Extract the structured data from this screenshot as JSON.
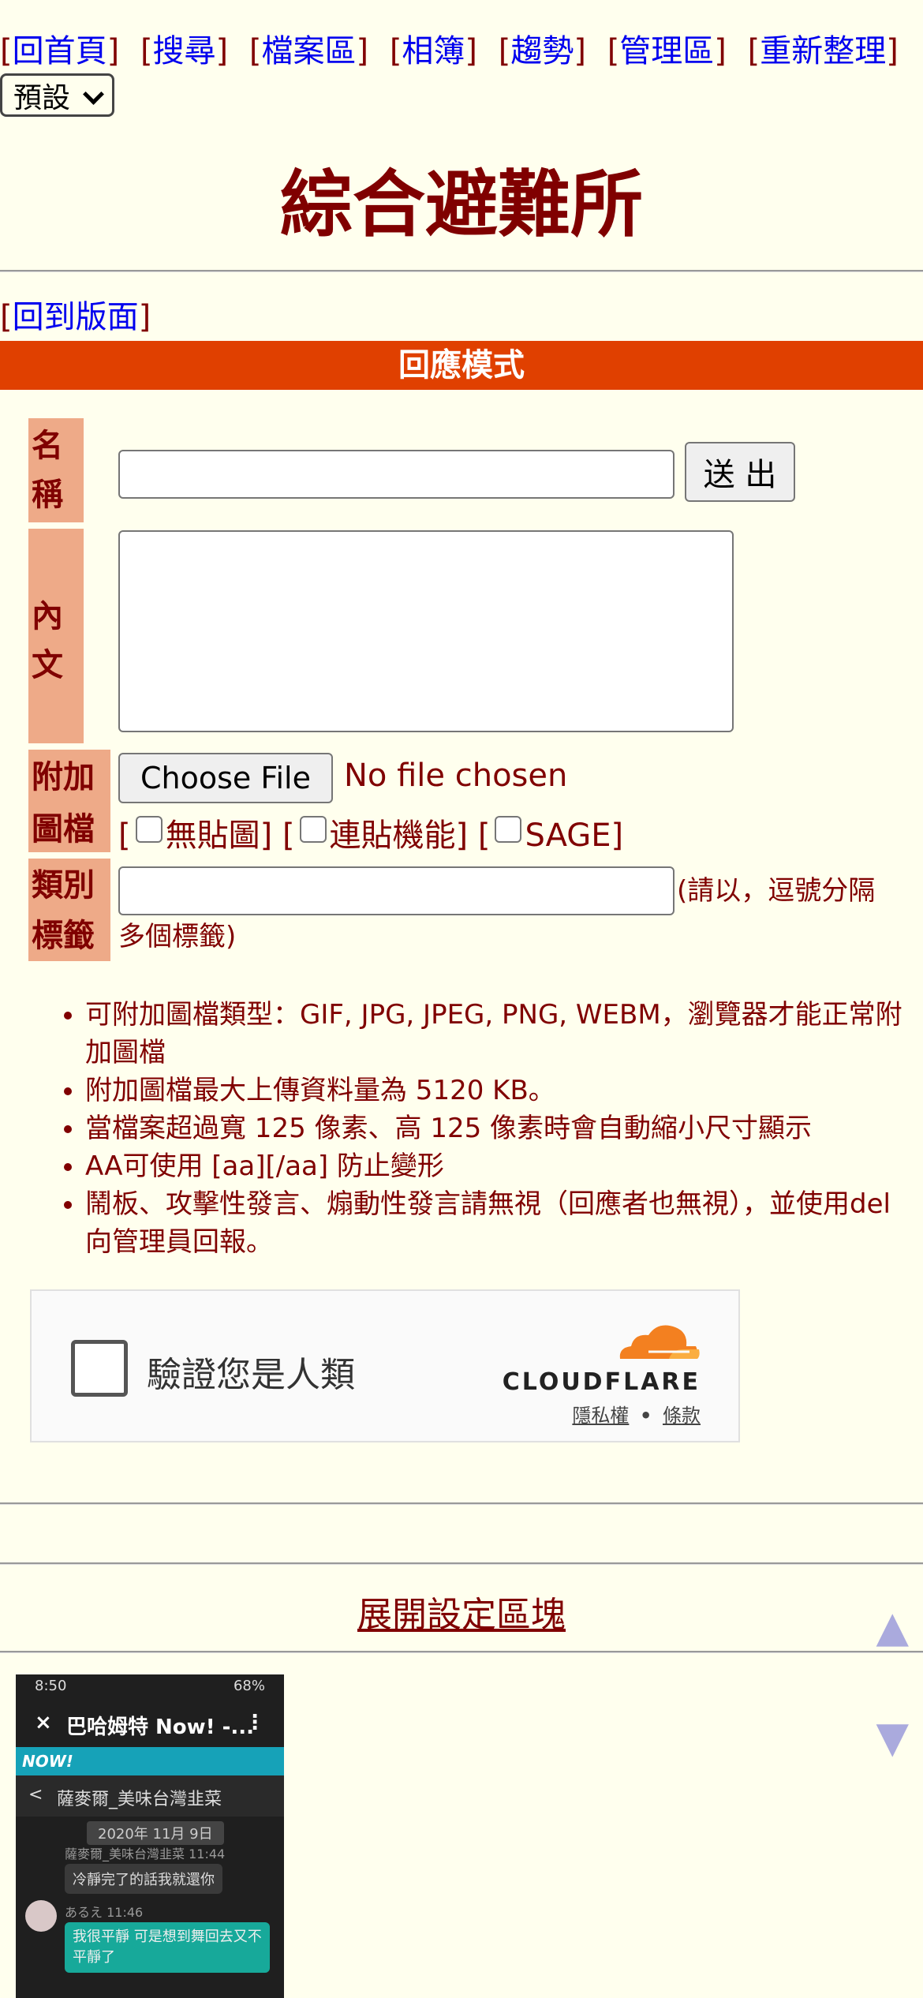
{
  "nav": {
    "items": [
      {
        "label": "回首頁"
      },
      {
        "label": "搜尋"
      },
      {
        "label": "檔案區"
      },
      {
        "label": "相簿"
      },
      {
        "label": "趨勢"
      },
      {
        "label": "管理區"
      },
      {
        "label": "重新整理"
      }
    ],
    "bracket_open": "[",
    "bracket_close": "]"
  },
  "style_select": {
    "value": "預設"
  },
  "board": {
    "title": "綜合避難所"
  },
  "back_link": {
    "label": "回到版面"
  },
  "mode_bar": {
    "label": "回應模式"
  },
  "form": {
    "name_label": "名稱",
    "name_value": "",
    "submit_label": "送 出",
    "body_label": "內文",
    "body_value": "",
    "attach_label": "附加圖檔",
    "choose_file_label": "Choose File",
    "no_file_text": "No file chosen",
    "opt_noimg_label": "無貼圖",
    "opt_link_label": "連貼機能",
    "opt_sage_label": "SAGE",
    "tag_label": "類別標籤",
    "tag_value": "",
    "tag_hint": "(請以，逗號分隔多個標籤)"
  },
  "rules": [
    "可附加圖檔類型：GIF, JPG, JPEG, PNG, WEBM，瀏覽器才能正常附加圖檔",
    "附加圖檔最大上傳資料量為 5120 KB。",
    "當檔案超過寬 125 像素、高 125 像素時會自動縮小尺寸顯示",
    "AA可使用 [aa][/aa] 防止變形",
    "鬧板、攻擊性發言、煽動性發言請無視（回應者也無視），並使用del向管理員回報。"
  ],
  "captcha": {
    "label": "驗證您是人類",
    "brand": "CLOUDFLARE",
    "privacy_label": "隱私權",
    "separator": "•",
    "terms_label": "條款",
    "brand_color": "#f38020"
  },
  "settings": {
    "expand_label": "展開設定區塊"
  },
  "scroll": {
    "up_icon": "▲",
    "down_icon": "▼"
  },
  "thumbnail": {
    "status_time": "8:50",
    "status_battery": "68%",
    "close_icon": "×",
    "app_title": "巴哈姆特 Now! -...",
    "menu_icon": "⋮",
    "brand_bar": "NOW!",
    "chat_back": "<",
    "chat_title": "薩麥爾_美味台灣韭菜",
    "date": "2020年 11月 9日",
    "msg1_name": "薩麥爾_美味台灣韭菜 11:44",
    "msg1_text": "冷靜完了的話我就還你",
    "msg2_name": "あるえ 11:46",
    "msg2_text": "我很平靜 可是想到舞回去又不平靜了"
  },
  "colors": {
    "background": "#ffffee",
    "text": "#800000",
    "link": "#0000ee",
    "mode_bar": "#e04000",
    "label_bg": "#eeaa88",
    "scroll_arrows": "#aaaadd"
  }
}
